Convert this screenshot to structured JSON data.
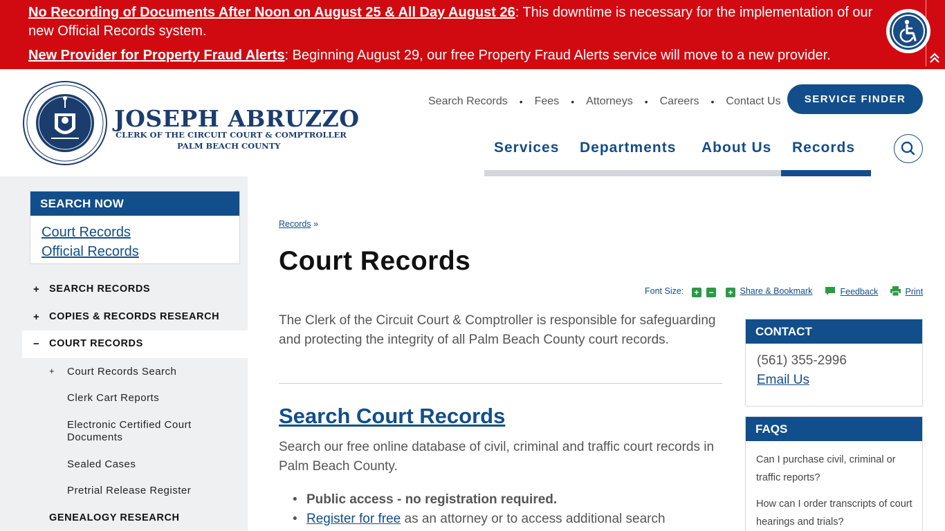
{
  "alerts": [
    {
      "link": "No Recording of Documents After Noon on August 25 & All Day August 26",
      "text": ": This downtime is necessary for the implementation of our new Official Records system."
    },
    {
      "link": "New Provider for Property Fraud Alerts",
      "text": ": Beginning August 29, our free Property Fraud Alerts service will move to a new provider."
    }
  ],
  "accessibility_icon": "wheelchair-icon",
  "collapse_icon": "double-chevron-up-icon",
  "logo": {
    "name": "JOSEPH ABRUZZO",
    "line1": "CLERK OF THE CIRCUIT COURT & COMPTROLLER",
    "line2": "PALM BEACH COUNTY"
  },
  "utility_nav": [
    "Search Records",
    "Fees",
    "Attorneys",
    "Careers",
    "Contact Us"
  ],
  "service_finder": "SERVICE FINDER",
  "main_nav": [
    "Services",
    "Departments",
    "About Us",
    "Records"
  ],
  "main_nav_active": "Records",
  "search_icon": "search-icon",
  "search_now": {
    "title": "SEARCH NOW",
    "links": [
      "Court Records",
      "Official Records"
    ]
  },
  "side_nav": [
    {
      "symbol": "+",
      "label": "SEARCH RECORDS"
    },
    {
      "symbol": "+",
      "label": "COPIES & RECORDS RESEARCH"
    },
    {
      "symbol": "−",
      "label": "COURT RECORDS"
    },
    {
      "symbol": "",
      "label": "GENEALOGY RESEARCH"
    }
  ],
  "side_sub": [
    {
      "symbol": "+",
      "label": "Court Records Search"
    },
    {
      "symbol": "",
      "label": "Clerk Cart Reports"
    },
    {
      "symbol": "",
      "label": "Electronic Certified Court Documents"
    },
    {
      "symbol": "",
      "label": "Sealed Cases"
    },
    {
      "symbol": "",
      "label": "Pretrial Release Register"
    }
  ],
  "breadcrumb": {
    "link": "Records",
    "sep": "»"
  },
  "page_title": "Court Records",
  "tools": {
    "font_size": "Font Size:",
    "share": "Share & Bookmark",
    "feedback": "Feedback",
    "print": "Print"
  },
  "intro": "The Clerk of the Circuit Court & Comptroller is responsible for safeguarding and protecting the integrity of all Palm Beach County court records.",
  "section": {
    "heading": "Search Court Records",
    "text": "Search our free online database of civil, criminal and traffic court records in Palm Beach County.",
    "bullet1": "Public access - no registration required.",
    "bullet2_link": "Register for free",
    "bullet2_text": " as an attorney or to access additional search"
  },
  "contact": {
    "title": "CONTACT",
    "phone": "(561) 355-2996",
    "email": "Email Us"
  },
  "faqs": {
    "title": "FAQS",
    "items": [
      "Can I purchase civil, criminal or traffic reports?",
      "How can I order transcripts of court hearings and trials?"
    ]
  }
}
